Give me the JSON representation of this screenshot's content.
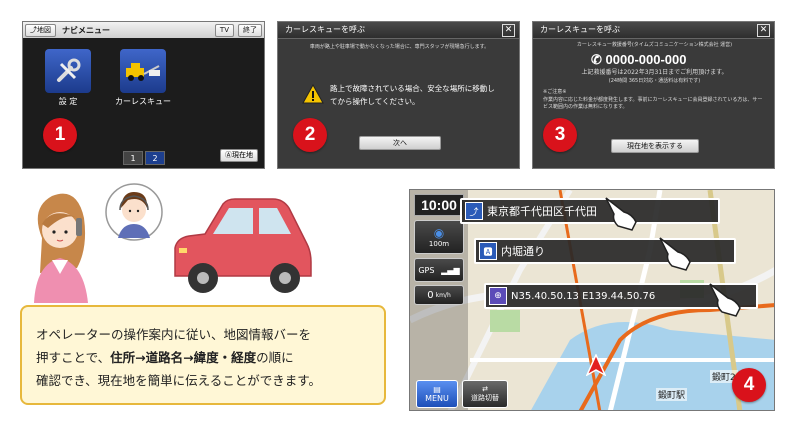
{
  "panel1": {
    "map_button": "地図",
    "title": "ナビメニュー",
    "tv_button": "TV",
    "exit_button": "終了",
    "tiles": [
      {
        "label": "設 定",
        "icon": "settings-tools-icon"
      },
      {
        "label": "カーレスキュー",
        "icon": "tow-truck-icon"
      }
    ],
    "pages": [
      "1",
      "2"
    ],
    "current_location_button": "現在地",
    "badge": "1"
  },
  "panel2": {
    "title": "カーレスキューを呼ぶ",
    "small_text": "車両が路上や駐車場で動かなくなった場合に、専門スタッフが現場急行します。",
    "warning_text": "路上で故障されている場合、安全な場所に移動してから操作してください。",
    "next_button": "次へ",
    "badge": "2"
  },
  "panel3": {
    "title": "カーレスキューを呼ぶ",
    "service_line": "カーレスキュー救援番号(タイムズコミュニケーション株式会社 運営)",
    "phone": "0000-000-000",
    "validity": "上記救援番号は2022年3月31日までご利用頂けます。",
    "hours": "(24時間 365日対応・通話料は有料です)",
    "notes_title": "※ご注意※",
    "notes": "作業内容に応じた料金が都度発生します。事前にカーレスキューに会員登録されている方は、サービス範囲内の作業は無料になります。",
    "show_location_button": "現在地を表示する",
    "badge": "3"
  },
  "map": {
    "time": "10:00",
    "scale": "100m",
    "gps": "GPS",
    "speed": "0",
    "speed_unit": "km/h",
    "address_bar": "東京都千代田区千代田",
    "road_bar": "内堀通り",
    "coord_bar": "N35.40.50.13 E139.44.50.76",
    "menu_button": "MENU",
    "road_switch_button": "道路切替",
    "labels": [
      "鍛町2",
      "鍛町駅"
    ],
    "badge": "4"
  },
  "message": {
    "line1": "オペレーターの操作案内に従い、地図情報バーを",
    "line2_pre": "押すことで、",
    "line2_bold": "住所→道路名→緯度・経度",
    "line2_post": "の順に",
    "line3": "確認でき、現在地を簡単に伝えることができます。"
  },
  "colors": {
    "badge": "#d9121b",
    "accent_road": "#e86a1c",
    "msg_bg": "#fff7d6"
  }
}
